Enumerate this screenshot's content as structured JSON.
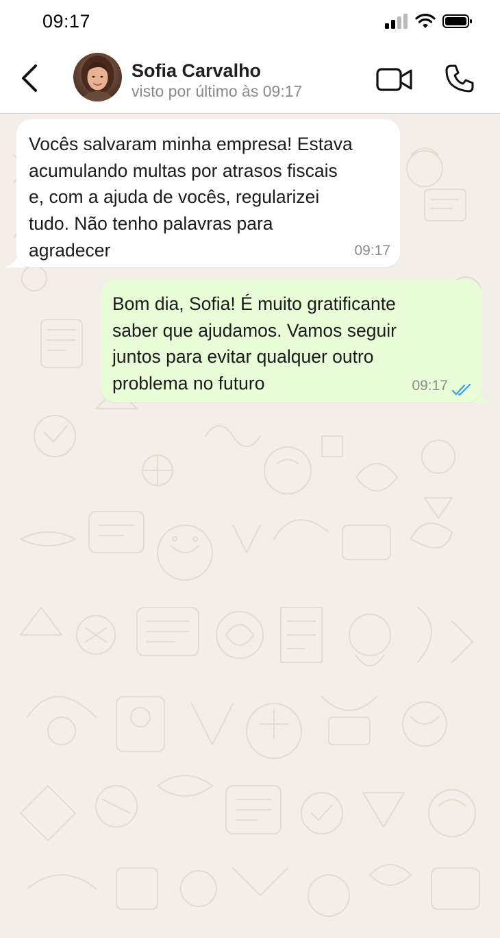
{
  "status_bar": {
    "time": "09:17"
  },
  "header": {
    "back_icon": "chevron-left-icon",
    "contact_name": "Sofia Carvalho",
    "contact_status": "visto por último às 09:17",
    "video_icon": "video-camera-icon",
    "call_icon": "phone-icon"
  },
  "messages": [
    {
      "direction": "incoming",
      "text": "Vocês salvaram minha empresa! Estava\nacumulando multas por atrasos fiscais\ne, com a ajuda de vocês, regularizei\ntudo. Não tenho palavras para\nagradecer",
      "time": "09:17"
    },
    {
      "direction": "outgoing",
      "text": "Bom dia, Sofia! É muito gratificante\nsaber que ajudamos. Vamos seguir\njuntos para evitar qualquer outro\nproblema no futuro",
      "time": "09:17",
      "read_icon": "double-check-icon",
      "read_color": "#4fa3e0"
    }
  ],
  "colors": {
    "incoming_bubble": "#ffffff",
    "outgoing_bubble": "#e7fcd7",
    "wallpaper": "#f3efe8",
    "wallpaper_doodle": "#e4dccf"
  }
}
